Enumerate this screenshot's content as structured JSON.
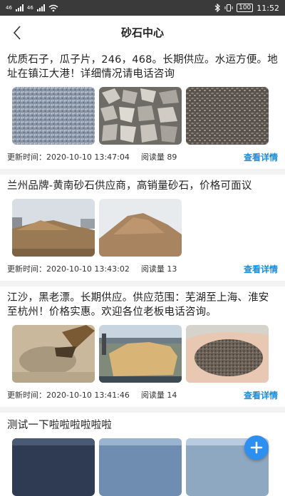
{
  "status_bar": {
    "network_1": "46",
    "network_2": "46",
    "battery": "100",
    "time": "11:52"
  },
  "header": {
    "title": "砂石中心"
  },
  "listings": [
    {
      "description": "优质石子，瓜子片，246，468。长期供应。水运方便。地址在镇江大港！详细情况请电话咨询",
      "updated_label": "更新时间：",
      "updated": "2020-10-10 13:47:04",
      "reads_label": "阅读量",
      "reads": "89",
      "detail_label": "查看详情"
    },
    {
      "description": "兰州品牌-黄南砂石供应商，高销量砂石，价格可面议",
      "updated_label": "更新时间：",
      "updated": "2020-10-10 13:43:02",
      "reads_label": "阅读量",
      "reads": "13",
      "detail_label": "查看详情"
    },
    {
      "description": "江沙，黑老漂。长期供应。供应范围：芜湖至上海、淮安至杭州！价格实惠。欢迎各位老板电话咨询。",
      "updated_label": "更新时间：",
      "updated": "2020-10-10 13:41:46",
      "reads_label": "阅读量",
      "reads": "14",
      "detail_label": "查看详情"
    },
    {
      "description": "测试一下啦啦啦啦啦啦"
    }
  ],
  "colors": {
    "accent": "#1a8cd8",
    "fab": "#2d8ff0",
    "status_bar": "#3a3a3a"
  }
}
